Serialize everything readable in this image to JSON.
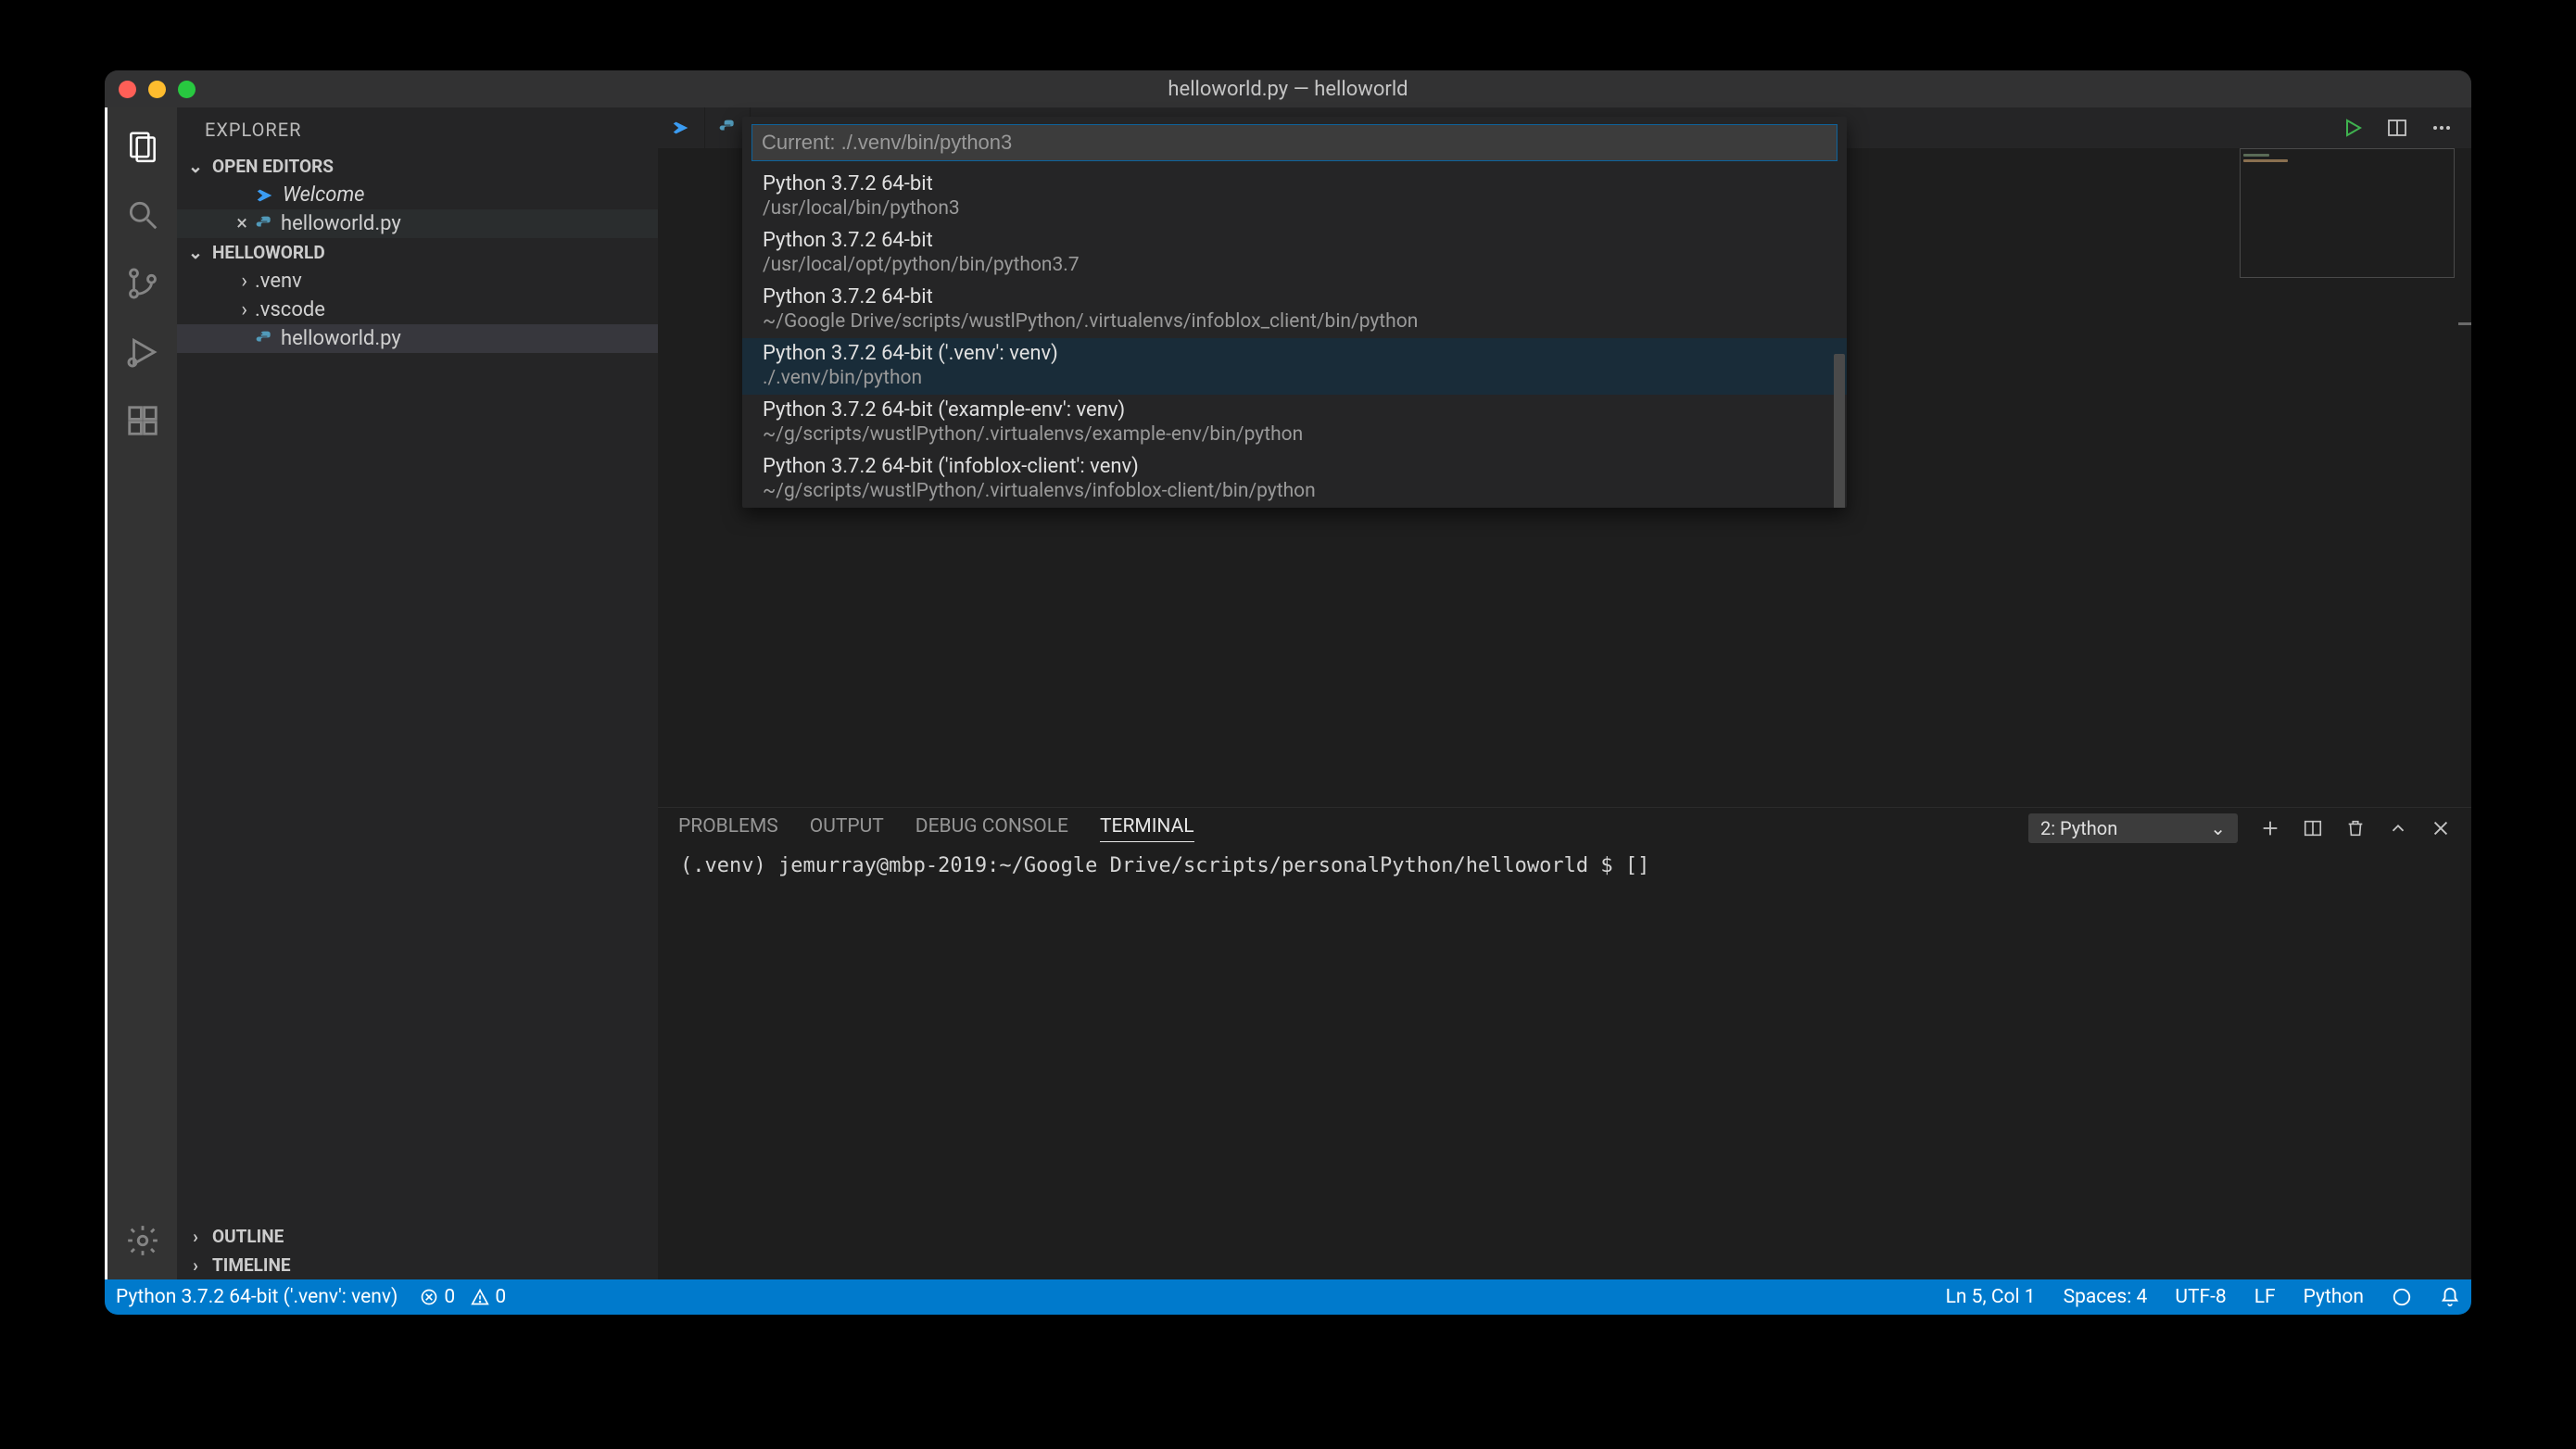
{
  "titlebar": {
    "title": "helloworld.py — helloworld"
  },
  "sidebar": {
    "title": "EXPLORER",
    "openEditors": {
      "header": "OPEN EDITORS",
      "items": [
        {
          "label": "Welcome",
          "icon": "vscode"
        },
        {
          "label": "helloworld.py",
          "icon": "python",
          "close": "×"
        }
      ]
    },
    "project": {
      "header": "HELLOWORLD",
      "items": [
        {
          "label": ".venv",
          "kind": "folder"
        },
        {
          "label": ".vscode",
          "kind": "folder"
        },
        {
          "label": "helloworld.py",
          "kind": "file",
          "selected": true
        }
      ]
    },
    "outline": {
      "header": "OUTLINE"
    },
    "timeline": {
      "header": "TIMELINE"
    }
  },
  "quickpick": {
    "placeholder": "Current: ./.venv/bin/python3",
    "items": [
      {
        "line1": "Python 3.7.2 64-bit",
        "line2": "/usr/local/bin/python3"
      },
      {
        "line1": "Python 3.7.2 64-bit",
        "line2": "/usr/local/opt/python/bin/python3.7"
      },
      {
        "line1": "Python 3.7.2 64-bit",
        "line2": "~/Google Drive/scripts/wustlPython/.virtualenvs/infoblox_client/bin/python"
      },
      {
        "line1": "Python 3.7.2 64-bit ('.venv': venv)",
        "line2": "./.venv/bin/python",
        "highlighted": true
      },
      {
        "line1": "Python 3.7.2 64-bit ('example-env': venv)",
        "line2": "~/g/scripts/wustlPython/.virtualenvs/example-env/bin/python"
      },
      {
        "line1": "Python 3.7.2 64-bit ('infoblox-client': venv)",
        "line2": "~/g/scripts/wustlPython/.virtualenvs/infoblox-client/bin/python"
      }
    ]
  },
  "panel": {
    "tabs": [
      "PROBLEMS",
      "OUTPUT",
      "DEBUG CONSOLE",
      "TERMINAL"
    ],
    "activeTab": "TERMINAL",
    "terminalSelect": "2: Python",
    "terminalLine": "(.venv) jemurray@mbp-2019:~/Google Drive/scripts/personalPython/helloworld $ []"
  },
  "statusbar": {
    "interpreter": "Python 3.7.2 64-bit ('.venv': venv)",
    "errors": "0",
    "warnings": "0",
    "cursor": "Ln 5, Col 1",
    "spaces": "Spaces: 4",
    "encoding": "UTF-8",
    "eol": "LF",
    "lang": "Python"
  }
}
